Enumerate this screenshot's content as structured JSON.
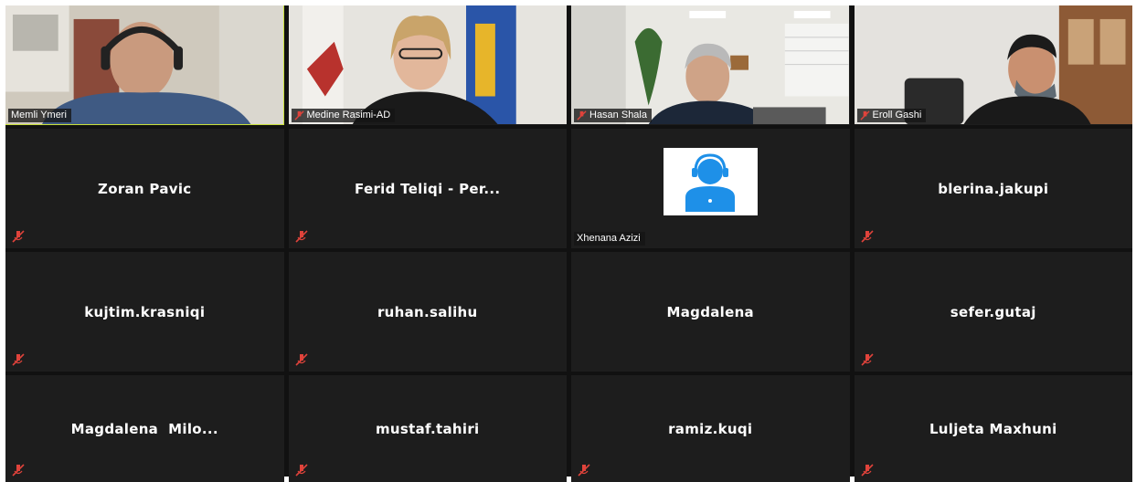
{
  "video_tiles": [
    {
      "name": "Memli Ymeri",
      "muted": false,
      "active": true
    },
    {
      "name": "Medine Rasimi-AD",
      "muted": true
    },
    {
      "name": "Hasan Shala",
      "muted": true
    },
    {
      "name": "Eroll Gashi",
      "muted": true
    }
  ],
  "avatar_tile": {
    "name": "Xhenana Azizi",
    "icon": "headset-user-icon",
    "icon_color": "#1e90e8"
  },
  "name_tiles": [
    "Zoran Pavic",
    "Ferid Teliqi - Per...",
    "blerina.jakupi",
    "kujtim.krasniqi",
    "ruhan.salihu",
    "Magdalena",
    "sefer.gutaj",
    "Magdalena  Milo...",
    "mustaf.tahiri",
    "ramiz.kuqi",
    "Luljeta Maxhuni"
  ],
  "colors": {
    "muted_icon": "#e0433b",
    "active_border": "#c9e03b",
    "tile_bg": "#1d1d1d"
  }
}
